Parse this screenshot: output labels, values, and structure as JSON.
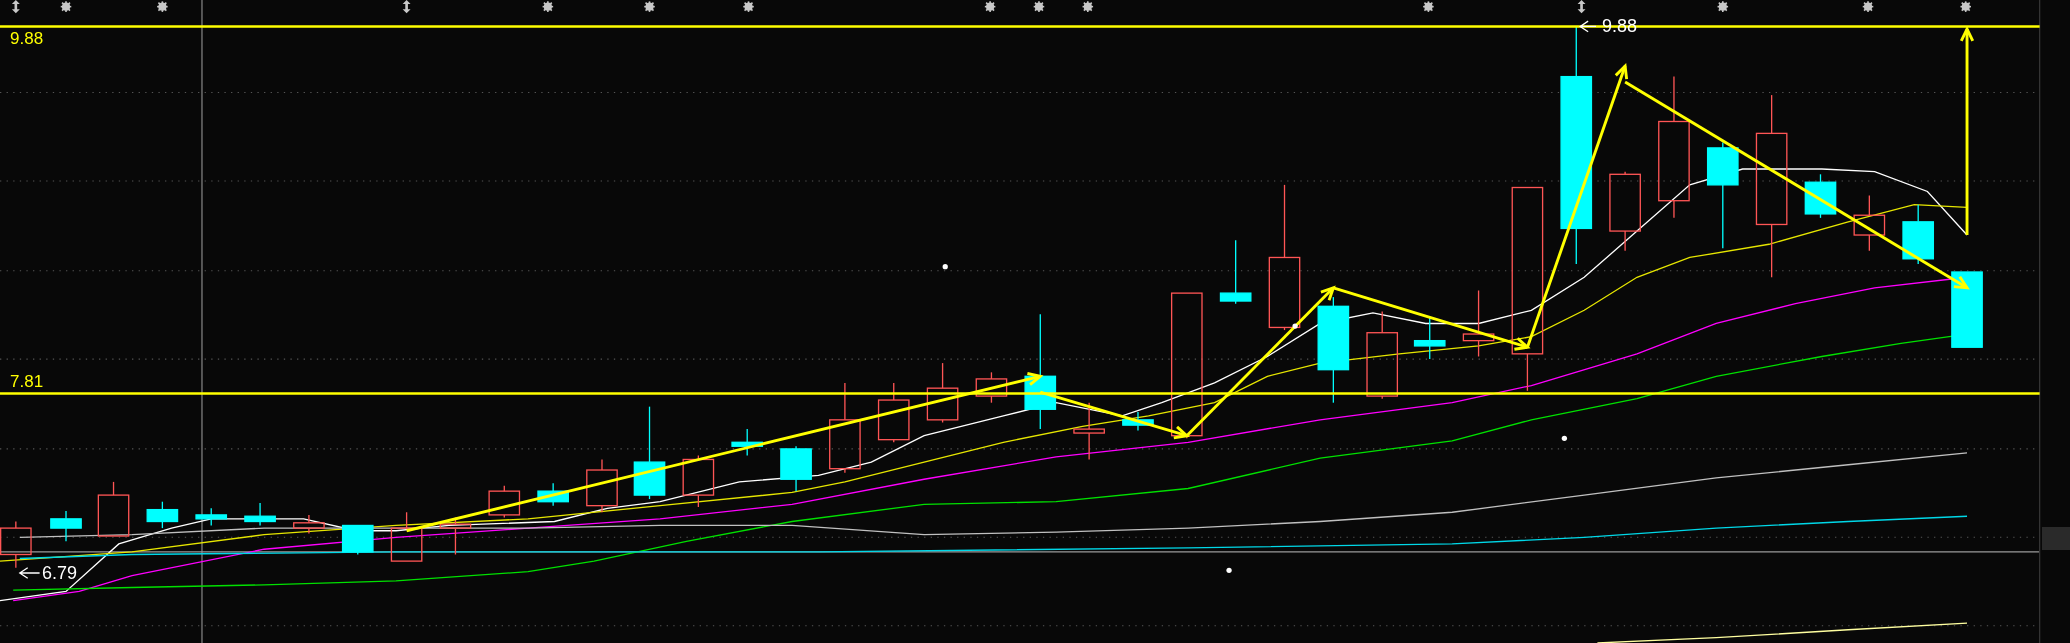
{
  "chart": {
    "price_levels": [
      {
        "label": "9.88"
      },
      {
        "label": "7.81"
      }
    ],
    "high_marker": {
      "label": "9.88"
    },
    "low_marker": {
      "label": "6.79"
    }
  }
}
